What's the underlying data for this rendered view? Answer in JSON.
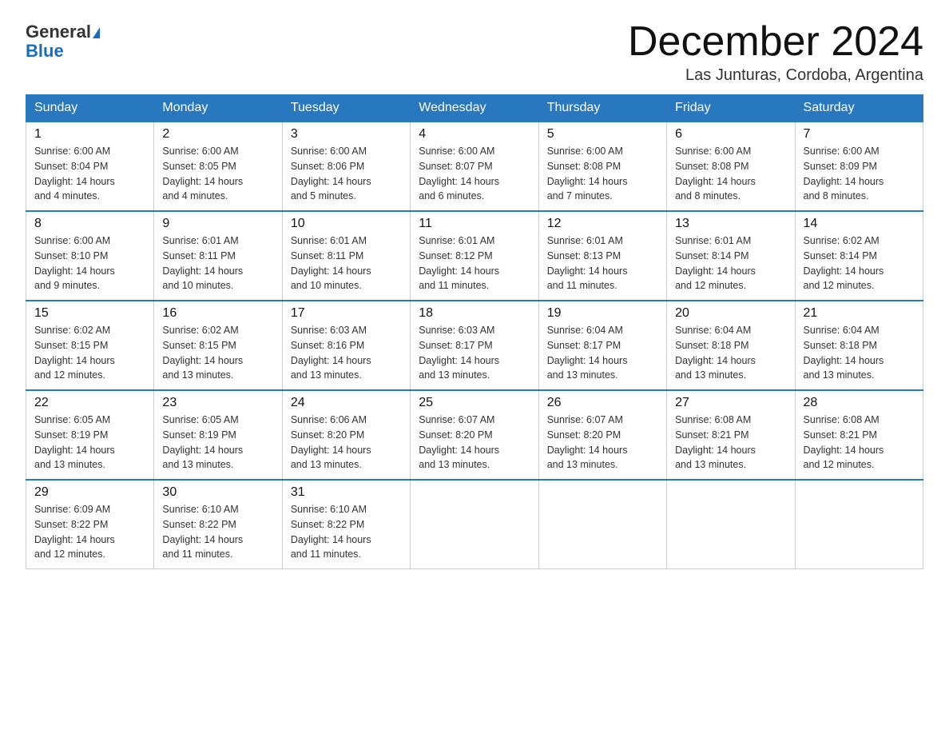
{
  "header": {
    "logo_line1": "General",
    "logo_line2": "Blue",
    "month_title": "December 2024",
    "location": "Las Junturas, Cordoba, Argentina"
  },
  "weekdays": [
    "Sunday",
    "Monday",
    "Tuesday",
    "Wednesday",
    "Thursday",
    "Friday",
    "Saturday"
  ],
  "weeks": [
    [
      {
        "day": 1,
        "sunrise": "6:00 AM",
        "sunset": "8:04 PM",
        "daylight": "14 hours and 4 minutes."
      },
      {
        "day": 2,
        "sunrise": "6:00 AM",
        "sunset": "8:05 PM",
        "daylight": "14 hours and 4 minutes."
      },
      {
        "day": 3,
        "sunrise": "6:00 AM",
        "sunset": "8:06 PM",
        "daylight": "14 hours and 5 minutes."
      },
      {
        "day": 4,
        "sunrise": "6:00 AM",
        "sunset": "8:07 PM",
        "daylight": "14 hours and 6 minutes."
      },
      {
        "day": 5,
        "sunrise": "6:00 AM",
        "sunset": "8:08 PM",
        "daylight": "14 hours and 7 minutes."
      },
      {
        "day": 6,
        "sunrise": "6:00 AM",
        "sunset": "8:08 PM",
        "daylight": "14 hours and 8 minutes."
      },
      {
        "day": 7,
        "sunrise": "6:00 AM",
        "sunset": "8:09 PM",
        "daylight": "14 hours and 8 minutes."
      }
    ],
    [
      {
        "day": 8,
        "sunrise": "6:00 AM",
        "sunset": "8:10 PM",
        "daylight": "14 hours and 9 minutes."
      },
      {
        "day": 9,
        "sunrise": "6:01 AM",
        "sunset": "8:11 PM",
        "daylight": "14 hours and 10 minutes."
      },
      {
        "day": 10,
        "sunrise": "6:01 AM",
        "sunset": "8:11 PM",
        "daylight": "14 hours and 10 minutes."
      },
      {
        "day": 11,
        "sunrise": "6:01 AM",
        "sunset": "8:12 PM",
        "daylight": "14 hours and 11 minutes."
      },
      {
        "day": 12,
        "sunrise": "6:01 AM",
        "sunset": "8:13 PM",
        "daylight": "14 hours and 11 minutes."
      },
      {
        "day": 13,
        "sunrise": "6:01 AM",
        "sunset": "8:14 PM",
        "daylight": "14 hours and 12 minutes."
      },
      {
        "day": 14,
        "sunrise": "6:02 AM",
        "sunset": "8:14 PM",
        "daylight": "14 hours and 12 minutes."
      }
    ],
    [
      {
        "day": 15,
        "sunrise": "6:02 AM",
        "sunset": "8:15 PM",
        "daylight": "14 hours and 12 minutes."
      },
      {
        "day": 16,
        "sunrise": "6:02 AM",
        "sunset": "8:15 PM",
        "daylight": "14 hours and 13 minutes."
      },
      {
        "day": 17,
        "sunrise": "6:03 AM",
        "sunset": "8:16 PM",
        "daylight": "14 hours and 13 minutes."
      },
      {
        "day": 18,
        "sunrise": "6:03 AM",
        "sunset": "8:17 PM",
        "daylight": "14 hours and 13 minutes."
      },
      {
        "day": 19,
        "sunrise": "6:04 AM",
        "sunset": "8:17 PM",
        "daylight": "14 hours and 13 minutes."
      },
      {
        "day": 20,
        "sunrise": "6:04 AM",
        "sunset": "8:18 PM",
        "daylight": "14 hours and 13 minutes."
      },
      {
        "day": 21,
        "sunrise": "6:04 AM",
        "sunset": "8:18 PM",
        "daylight": "14 hours and 13 minutes."
      }
    ],
    [
      {
        "day": 22,
        "sunrise": "6:05 AM",
        "sunset": "8:19 PM",
        "daylight": "14 hours and 13 minutes."
      },
      {
        "day": 23,
        "sunrise": "6:05 AM",
        "sunset": "8:19 PM",
        "daylight": "14 hours and 13 minutes."
      },
      {
        "day": 24,
        "sunrise": "6:06 AM",
        "sunset": "8:20 PM",
        "daylight": "14 hours and 13 minutes."
      },
      {
        "day": 25,
        "sunrise": "6:07 AM",
        "sunset": "8:20 PM",
        "daylight": "14 hours and 13 minutes."
      },
      {
        "day": 26,
        "sunrise": "6:07 AM",
        "sunset": "8:20 PM",
        "daylight": "14 hours and 13 minutes."
      },
      {
        "day": 27,
        "sunrise": "6:08 AM",
        "sunset": "8:21 PM",
        "daylight": "14 hours and 13 minutes."
      },
      {
        "day": 28,
        "sunrise": "6:08 AM",
        "sunset": "8:21 PM",
        "daylight": "14 hours and 12 minutes."
      }
    ],
    [
      {
        "day": 29,
        "sunrise": "6:09 AM",
        "sunset": "8:22 PM",
        "daylight": "14 hours and 12 minutes."
      },
      {
        "day": 30,
        "sunrise": "6:10 AM",
        "sunset": "8:22 PM",
        "daylight": "14 hours and 11 minutes."
      },
      {
        "day": 31,
        "sunrise": "6:10 AM",
        "sunset": "8:22 PM",
        "daylight": "14 hours and 11 minutes."
      },
      null,
      null,
      null,
      null
    ]
  ],
  "labels": {
    "sunrise": "Sunrise:",
    "sunset": "Sunset:",
    "daylight": "Daylight:"
  }
}
